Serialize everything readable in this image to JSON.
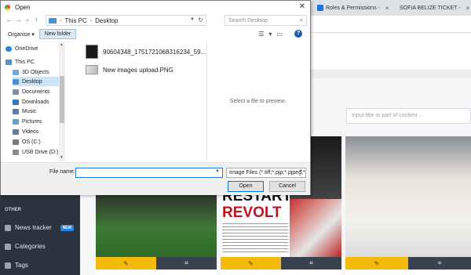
{
  "browser": {
    "tabs": [
      {
        "label": "Roles & Permissions -",
        "close": "×"
      },
      {
        "label": "SOFIA BELIZE TICKET -",
        "close": "×"
      }
    ]
  },
  "app": {
    "search_placeholder": "Input title or part of content ...",
    "sidebar": {
      "section": "OTHER",
      "items": [
        {
          "label": "News tracker",
          "badge": "NEW"
        },
        {
          "label": "Categories"
        },
        {
          "label": "Tags"
        }
      ]
    },
    "cards": [
      {
        "edit": "✎",
        "crop": "⌗"
      },
      {
        "edit": "✎",
        "crop": "⌗",
        "headline_1": "RESTART",
        "headline_2": "REVOLT"
      },
      {
        "edit": "✎",
        "crop": "⌗"
      }
    ]
  },
  "dialog": {
    "title": "Open",
    "close": "✕",
    "nav": {
      "back": "←",
      "forward": "→",
      "dropdown": "⌄",
      "up": "↑"
    },
    "breadcrumb": [
      "This PC",
      "Desktop"
    ],
    "search_placeholder": "Search Desktop",
    "toolbar": {
      "organise": "Organise ▾",
      "new_folder": "New folder",
      "help": "?"
    },
    "nav_pane": [
      {
        "label": "OneDrive",
        "color": "#1e88e5"
      },
      {
        "label": "This PC",
        "color": "#5a8fc9"
      },
      {
        "label": "3D Objects",
        "color": "#6fa8dc"
      },
      {
        "label": "Desktop",
        "color": "#4a90d9",
        "selected": true
      },
      {
        "label": "Documents",
        "color": "#7d8fa3"
      },
      {
        "label": "Downloads",
        "color": "#2f78c4"
      },
      {
        "label": "Music",
        "color": "#5b7ea8"
      },
      {
        "label": "Pictures",
        "color": "#6fa0c7"
      },
      {
        "label": "Videos",
        "color": "#5e7fa0"
      },
      {
        "label": "OS (C:)",
        "color": "#7a7a7a"
      },
      {
        "label": "USB Drive (D:)",
        "color": "#8a8a8a"
      }
    ],
    "files": [
      {
        "name": "90604348_1751721068316234_59...",
        "kind": "dark"
      },
      {
        "name": "New images upload.PNG",
        "kind": "png"
      }
    ],
    "preview_text": "Select a file to preview.",
    "filename_label": "File name:",
    "filename_value": "",
    "filetype": "Image Files (*.tiff;*.pjp;*.pjpeg;*",
    "open": "Open",
    "cancel": "Cancel"
  }
}
